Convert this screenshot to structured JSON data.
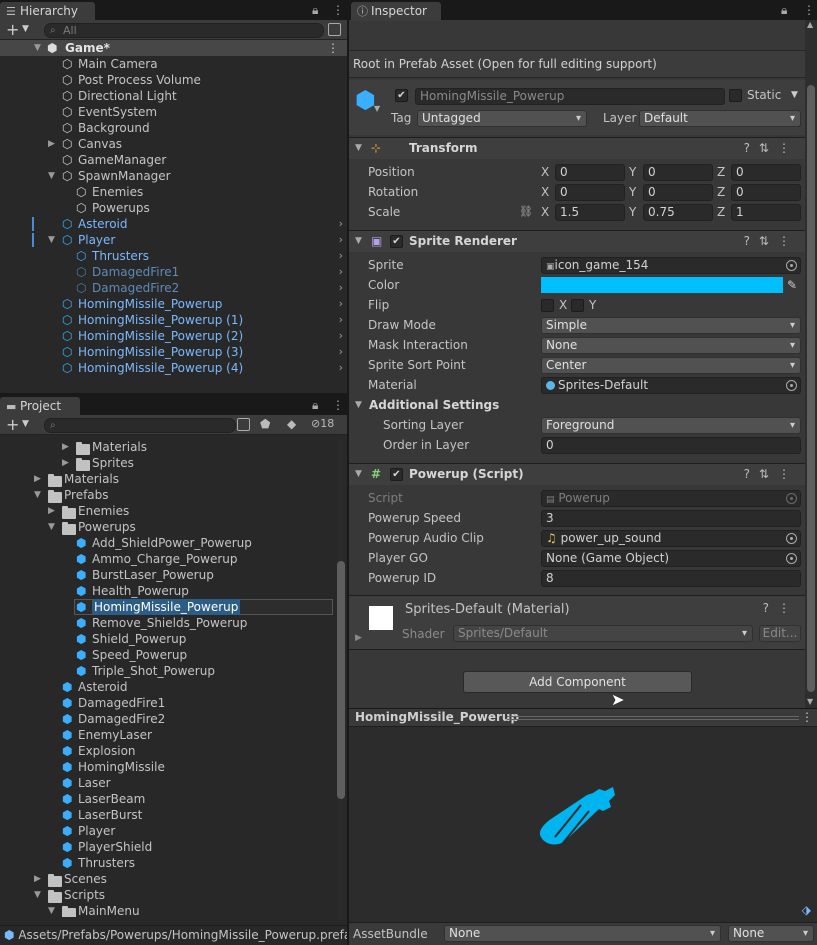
{
  "hierarchy": {
    "tab_label": "Hierarchy",
    "search_placeholder": "All",
    "scene": "Game*",
    "items": [
      {
        "label": "Main Camera"
      },
      {
        "label": "Post Process Volume"
      },
      {
        "label": "Directional Light"
      },
      {
        "label": "EventSystem"
      },
      {
        "label": "Background"
      },
      {
        "label": "Canvas"
      },
      {
        "label": "GameManager"
      },
      {
        "label": "SpawnManager"
      },
      {
        "label": "Enemies"
      },
      {
        "label": "Powerups"
      },
      {
        "label": "Asteroid"
      },
      {
        "label": "Player"
      },
      {
        "label": "Thrusters"
      },
      {
        "label": "DamagedFire1"
      },
      {
        "label": "DamagedFire2"
      },
      {
        "label": "HomingMissile_Powerup"
      },
      {
        "label": "HomingMissile_Powerup (1)"
      },
      {
        "label": "HomingMissile_Powerup (2)"
      },
      {
        "label": "HomingMissile_Powerup (3)"
      },
      {
        "label": "HomingMissile_Powerup (4)"
      }
    ]
  },
  "project": {
    "tab_label": "Project",
    "hidden_count": "18",
    "items": [
      {
        "label": "Materials"
      },
      {
        "label": "Sprites"
      },
      {
        "label": "Materials"
      },
      {
        "label": "Prefabs"
      },
      {
        "label": "Enemies"
      },
      {
        "label": "Powerups"
      },
      {
        "label": "Add_ShieldPower_Powerup"
      },
      {
        "label": "Ammo_Charge_Powerup"
      },
      {
        "label": "BurstLaser_Powerup"
      },
      {
        "label": "Health_Powerup"
      },
      {
        "label": "HomingMissile_Powerup"
      },
      {
        "label": "Remove_Shields_Powerup"
      },
      {
        "label": "Shield_Powerup"
      },
      {
        "label": "Speed_Powerup"
      },
      {
        "label": "Triple_Shot_Powerup"
      },
      {
        "label": "Asteroid"
      },
      {
        "label": "DamagedFire1"
      },
      {
        "label": "DamagedFire2"
      },
      {
        "label": "EnemyLaser"
      },
      {
        "label": "Explosion"
      },
      {
        "label": "HomingMissile"
      },
      {
        "label": "Laser"
      },
      {
        "label": "LaserBeam"
      },
      {
        "label": "LaserBurst"
      },
      {
        "label": "Player"
      },
      {
        "label": "PlayerShield"
      },
      {
        "label": "Thrusters"
      },
      {
        "label": "Scenes"
      },
      {
        "label": "Scripts"
      },
      {
        "label": "MainMenu"
      }
    ],
    "path": "Assets/Prefabs/Powerups/HomingMissile_Powerup.prefab"
  },
  "inspector": {
    "tab_label": "Inspector",
    "notice": "Root in Prefab Asset (Open for full editing support)",
    "object_name": "HomingMissile_Powerup",
    "static_label": "Static",
    "tag_label": "Tag",
    "tag_value": "Untagged",
    "layer_label": "Layer",
    "layer_value": "Default",
    "transform": {
      "title": "Transform",
      "position_label": "Position",
      "rotation_label": "Rotation",
      "scale_label": "Scale",
      "x": "X",
      "y": "Y",
      "z": "Z",
      "position": [
        "0",
        "0",
        "0"
      ],
      "rotation": [
        "0",
        "0",
        "0"
      ],
      "scale": [
        "1.5",
        "0.75",
        "1"
      ]
    },
    "sprite_renderer": {
      "title": "Sprite Renderer",
      "sprite_label": "Sprite",
      "sprite_value": "icon_game_154",
      "color_label": "Color",
      "color_value": "#00bfff",
      "flip_label": "Flip",
      "flip_x": "X",
      "flip_y": "Y",
      "draw_mode_label": "Draw Mode",
      "draw_mode_value": "Simple",
      "mask_label": "Mask Interaction",
      "mask_value": "None",
      "sort_point_label": "Sprite Sort Point",
      "sort_point_value": "Center",
      "material_label": "Material",
      "material_value": "Sprites-Default",
      "additional_label": "Additional Settings",
      "sorting_layer_label": "Sorting Layer",
      "sorting_layer_value": "Foreground",
      "order_label": "Order in Layer",
      "order_value": "0"
    },
    "powerup": {
      "title": "Powerup (Script)",
      "script_label": "Script",
      "script_value": "Powerup",
      "speed_label": "Powerup Speed",
      "speed_value": "3",
      "audio_label": "Powerup Audio Clip",
      "audio_value": "power_up_sound",
      "player_label": "Player GO",
      "player_value": "None (Game Object)",
      "id_label": "Powerup ID",
      "id_value": "8"
    },
    "material": {
      "title": "Sprites-Default (Material)",
      "shader_label": "Shader",
      "shader_value": "Sprites/Default",
      "edit_label": "Edit..."
    },
    "add_component": "Add Component"
  },
  "preview": {
    "title": "HomingMissile_Powerup",
    "icon_color": "#00b4f0"
  },
  "assetbundle": {
    "label": "AssetBundle",
    "value1": "None",
    "value2": "None"
  },
  "colors": {
    "accent": "#7ab8ff",
    "selection": "#2c5d87"
  }
}
